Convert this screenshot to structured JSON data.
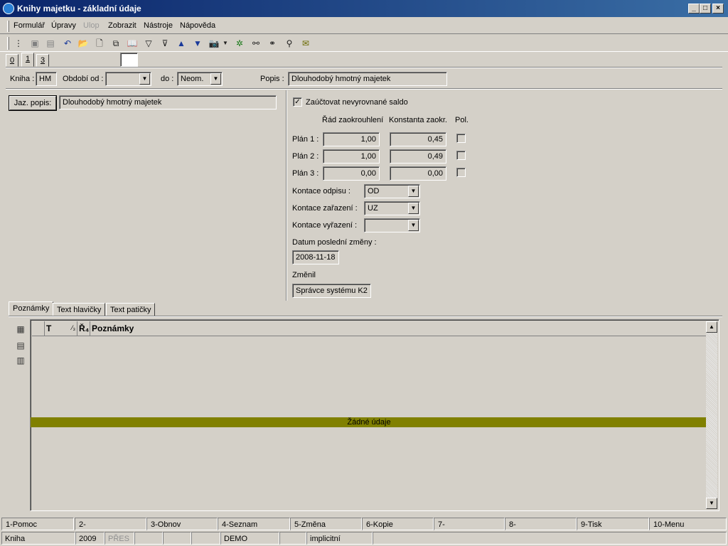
{
  "window": {
    "title": "Knihy majetku - základní údaje"
  },
  "menu": [
    {
      "label": "Formulář",
      "enabled": true
    },
    {
      "label": "Úpravy",
      "enabled": true
    },
    {
      "label": "Ulop",
      "enabled": false
    },
    {
      "label": "Zobrazit",
      "enabled": true
    },
    {
      "label": "Nástroje",
      "enabled": true
    },
    {
      "label": "Nápověda",
      "enabled": true
    }
  ],
  "top_tabs": [
    "0",
    "1",
    "3"
  ],
  "header": {
    "kniha_label": "Kniha :",
    "kniha_value": "HM",
    "obdobi_od_label": "Období od :",
    "obdobi_od_value": "",
    "do_label": "do :",
    "do_value": "Neom.",
    "popis_label": "Popis :",
    "popis_value": "Dlouhodobý hmotný majetek"
  },
  "left": {
    "jaz_popis_button": "Jaz. popis:",
    "jaz_popis_value": "Dlouhodobý hmotný majetek"
  },
  "right": {
    "zauctovat_label": "Zaúčtovat nevyrovnané saldo",
    "zauctovat_checked": "✓",
    "col_rad": "Řád zaokrouhlení",
    "col_konst": "Konstanta zaokr.",
    "col_pol": "Pol.",
    "plans": [
      {
        "label": "Plán 1 :",
        "rad": "1,00",
        "konst": "0,45"
      },
      {
        "label": "Plán 2 :",
        "rad": "1,00",
        "konst": "0,49"
      },
      {
        "label": "Plán 3 :",
        "rad": "0,00",
        "konst": "0,00"
      }
    ],
    "kontace_odpisu_label": "Kontace odpisu :",
    "kontace_odpisu_value": "OD",
    "kontace_zarazeni_label": "Kontace zařazení :",
    "kontace_zarazeni_value": "UZ",
    "kontace_vyrazeni_label": "Kontace vyřazení :",
    "kontace_vyrazeni_value": "",
    "datum_label": "Datum poslední změny :",
    "datum_value": "2008-11-18",
    "zmenil_label": "Změnil",
    "zmenil_value": "Správce systému K2"
  },
  "bottom_tabs": [
    "Poznámky",
    "Text hlavičky",
    "Text patičky"
  ],
  "grid": {
    "col_t": "T",
    "col_sort": "⁄₃",
    "col_r": "Ř₄",
    "col_poznamky": "Poznámky",
    "empty_text": "Žádné údaje",
    "empty_color": "#808000"
  },
  "fkeys": [
    "1-Pomoc",
    "2-",
    "3-Obnov",
    "4-Seznam",
    "5-Změna",
    "6-Kopie",
    "7-",
    "8-",
    "9-Tisk",
    "10-Menu"
  ],
  "status": {
    "kniha": "Kniha",
    "year": "2009",
    "mode": "PŘES",
    "db": "DEMO",
    "profile": "implicitní"
  }
}
